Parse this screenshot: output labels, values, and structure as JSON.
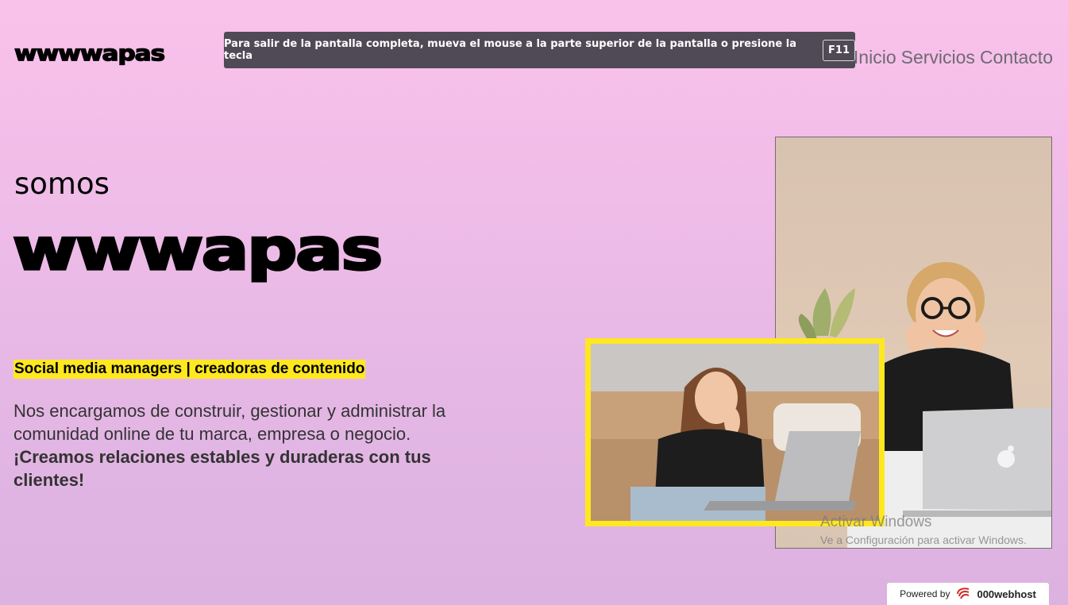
{
  "header": {
    "logo": "wwwwapas",
    "nav": [
      "Inicio",
      "Servicios",
      "Contacto"
    ]
  },
  "fullscreen_banner": {
    "message": "Para salir de la pantalla completa, mueva el mouse a la parte superior de la pantalla o presione la tecla",
    "key": "F11"
  },
  "hero": {
    "intro": "somos",
    "title": "wwwapas",
    "tagline": "Social media managers | creadoras de contenido",
    "description": "Nos encargamos de construir, gestionar y administrar la comunidad online de tu marca, empresa o negocio.",
    "highlight": "¡Creamos relaciones estables y duraderas con tus clientes!"
  },
  "images": {
    "large": "woman-with-glasses-laptop-photo",
    "small": "woman-on-couch-laptop-photo"
  },
  "windows_watermark": {
    "line1": "Activar Windows",
    "line2": "Ve a Configuración para activar Windows."
  },
  "footer_badge": {
    "label": "Powered by",
    "brand": "000webhost"
  },
  "colors": {
    "accent_yellow": "#ffe81f",
    "background_top": "#f9c2ea",
    "background_bottom": "#dcb2e0",
    "banner_bg": "#4f4a56"
  }
}
